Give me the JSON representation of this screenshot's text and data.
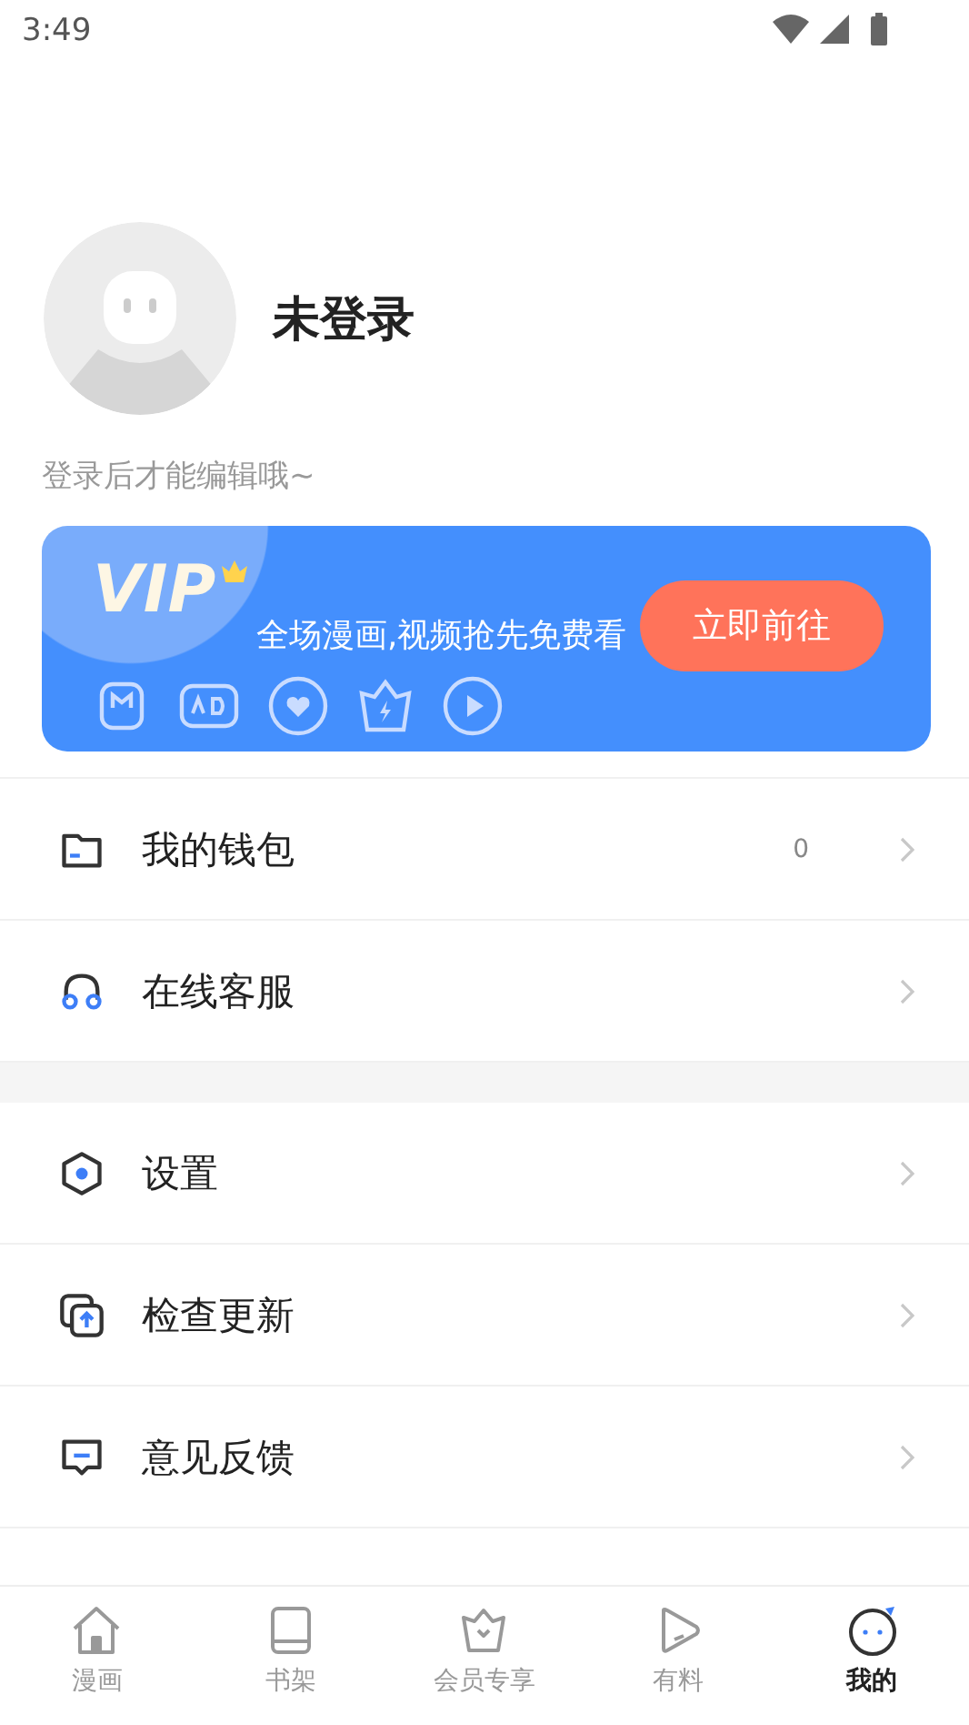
{
  "status_bar": {
    "time": "3:49"
  },
  "profile": {
    "name": "未登录",
    "hint": "登录后才能编辑哦~"
  },
  "vip_card": {
    "badge": "VIP",
    "slogan": "全场漫画,视频抢先免费看",
    "button": "立即前往"
  },
  "menu_groups": [
    {
      "items": [
        {
          "kind": "wallet",
          "label": "我的钱包",
          "value": "0"
        },
        {
          "kind": "support",
          "label": "在线客服"
        }
      ]
    },
    {
      "items": [
        {
          "kind": "settings",
          "label": "设置"
        },
        {
          "kind": "update",
          "label": "检查更新"
        },
        {
          "kind": "feedback",
          "label": "意见反馈"
        }
      ]
    }
  ],
  "tab_bar": [
    {
      "kind": "home",
      "label": "漫画",
      "selected": false
    },
    {
      "kind": "book",
      "label": "书架",
      "selected": false
    },
    {
      "kind": "crown",
      "label": "会员专享",
      "selected": false
    },
    {
      "kind": "play",
      "label": "有料",
      "selected": false
    },
    {
      "kind": "face",
      "label": "我的",
      "selected": true
    }
  ]
}
